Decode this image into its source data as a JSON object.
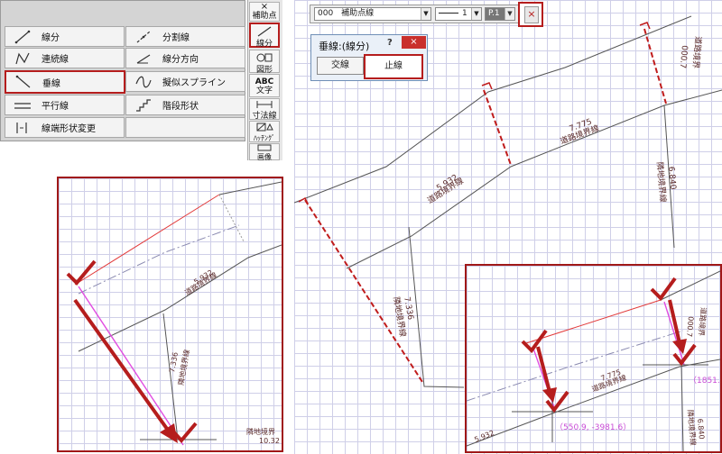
{
  "menu": {
    "items": [
      {
        "label": "線分",
        "icon": "line-segment-icon"
      },
      {
        "label": "分割線",
        "icon": "divide-line-icon"
      },
      {
        "label": "連続線",
        "icon": "polyline-icon"
      },
      {
        "label": "線分方向",
        "icon": "line-direction-icon"
      },
      {
        "label": "垂線",
        "icon": "perpendicular-icon"
      },
      {
        "label": "擬似スプライン",
        "icon": "spline-icon"
      },
      {
        "label": "平行線",
        "icon": "parallel-line-icon"
      },
      {
        "label": "階段形状",
        "icon": "stairs-icon"
      },
      {
        "label": "線端形状変更",
        "icon": "line-end-icon"
      }
    ]
  },
  "tools": {
    "aux_point_label": "補助点",
    "line_label": "線分",
    "figure_label": "図形",
    "abc_label": "ABC",
    "text_label": "文字",
    "dim_label": "寸法線",
    "hatch_label": "ﾊｯﾁﾝｸﾞ",
    "image_label": "画像"
  },
  "toolbar": {
    "layer_value": "000　補助点線",
    "width_value": "1",
    "pen_value": "P.1"
  },
  "dialog": {
    "title": "垂線:(線分)",
    "help": "?",
    "cross_label": "交線",
    "stop_label": "止線"
  },
  "drawing": {
    "len_5932": "5.932",
    "len_7775": "7.775",
    "len_7336": "7.336",
    "len_6840": "6.840",
    "len_0007": "000.7",
    "label_road": "道路境界線",
    "label_neighbor": "隣地境界線",
    "label_road_short": "道路境界",
    "detail_label_a": "隣地境界",
    "detail_label_b": "10.32"
  },
  "coords": {
    "point_a": "（550.9, -3981.6）",
    "point_b": "（1851."
  },
  "colors": {
    "highlight": "#b51d1d",
    "red_line": "#cc1b1b",
    "magenta": "#e14de1"
  }
}
